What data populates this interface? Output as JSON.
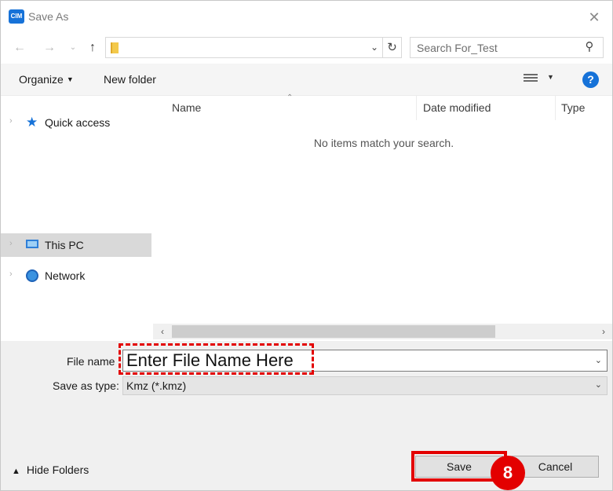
{
  "window": {
    "title": "Save As",
    "app_icon_text": "CIM"
  },
  "address": {
    "search_placeholder": "Search For_Test"
  },
  "toolbar": {
    "organize_label": "Organize",
    "new_folder_label": "New folder",
    "help_glyph": "?"
  },
  "nav_pane": {
    "items": [
      {
        "label": "Quick access",
        "icon": "star-icon"
      },
      {
        "label": "This PC",
        "icon": "computer-icon"
      },
      {
        "label": "Network",
        "icon": "network-icon"
      }
    ]
  },
  "file_list": {
    "columns": [
      "Name",
      "Date modified",
      "Type"
    ],
    "empty_message": "No items match your search."
  },
  "form": {
    "file_name_label": "File name",
    "file_name_value": "Enter File Name Here",
    "save_as_type_label": "Save as type:",
    "save_as_type_value": "Kmz (*.kmz)"
  },
  "footer": {
    "hide_folders_label": "Hide Folders",
    "save_label": "Save",
    "cancel_label": "Cancel"
  },
  "annotation": {
    "step_number": "8",
    "highlight_color": "#e30000"
  },
  "colors": {
    "accent": "#1672d8"
  }
}
